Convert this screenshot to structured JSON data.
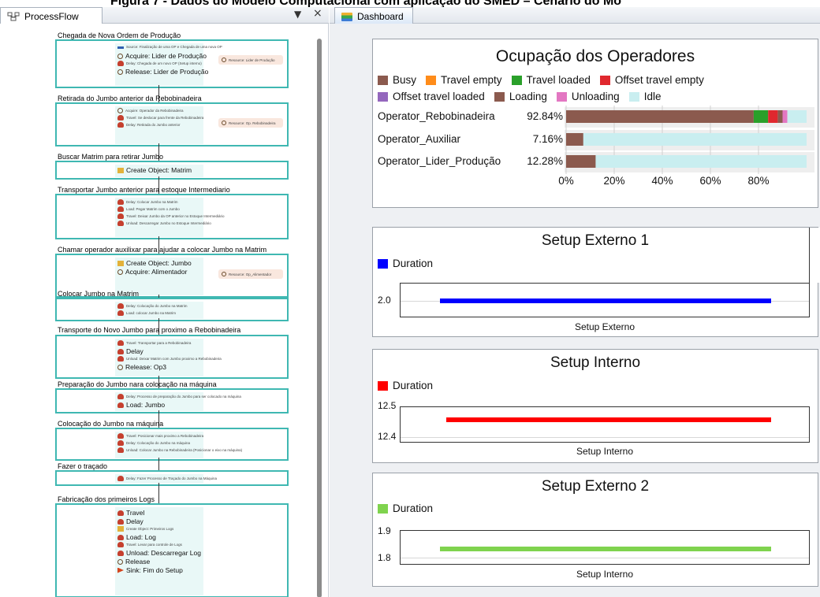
{
  "caption": "Figura 7 - Dados do Modelo Computacional com aplicação do SMED – Cenário do Mo",
  "left_panel": {
    "tab_label": "ProcessFlow",
    "pin_glyph": "▼",
    "close_glyph": "×",
    "blocks": [
      {
        "title": "Chegada de Nova Ordem de Produção",
        "activities": [
          {
            "text": "Source: Finalização de uma OP e Chegada de uma nova OP",
            "size": "sm",
            "icon": "source"
          },
          {
            "text": "Acquire: Lider de Produção",
            "size": "big",
            "icon": "acquire"
          },
          {
            "text": "Delay: Chegada de um novo OP (Setup interno)",
            "size": "sm",
            "icon": "delay"
          },
          {
            "text": "Release: Lider de Produção",
            "size": "big",
            "icon": "release"
          }
        ],
        "resource": "Resource: Lider de Produção"
      },
      {
        "title": "Retirada do Jumbo anterior da Rebobinadeira",
        "activities": [
          {
            "text": "Acquire: Operador da Rebobinadeira",
            "size": "sm",
            "icon": "acquire"
          },
          {
            "text": "Travel: Se deslocar para frente da Rebobinadeira",
            "size": "sm",
            "icon": "travel"
          },
          {
            "text": "Delay: Retirada do Jumbo anterior",
            "size": "sm",
            "icon": "delay"
          }
        ],
        "resource": "Resource: Op. Rebobinadeira"
      },
      {
        "title": "Buscar Matrim para retirar Jumbo",
        "activities": [
          {
            "text": "Create Object: Matrim",
            "size": "big",
            "icon": "create"
          }
        ],
        "resource": ""
      },
      {
        "title": "Transportar Jumbo anterior  para estoque Intermediario",
        "activities": [
          {
            "text": "Delay: Colocar Jumbo na Matrim",
            "size": "sm",
            "icon": "delay"
          },
          {
            "text": "Load: Pegar Matrim com o Jumbo",
            "size": "sm",
            "icon": "load"
          },
          {
            "text": "Travel: Deixar Jumbo da OP anterior no Estoque Intermediário",
            "size": "sm",
            "icon": "travel"
          },
          {
            "text": "Unload: Descarregar Jumbo no Estoque Intermediário",
            "size": "sm",
            "icon": "unload"
          }
        ],
        "resource": ""
      },
      {
        "title": "Chamar operador auxilixar para ajudar a colocar Jumbo na Matrim",
        "activities": [
          {
            "text": "Create Object: Jumbo",
            "size": "big",
            "icon": "create"
          },
          {
            "text": "Acquire: Alimentador",
            "size": "big",
            "icon": "acquire"
          }
        ],
        "resource": "Resource: Op_Alimentador"
      },
      {
        "title": "Colocar Jumbo na Matrim",
        "activities": [
          {
            "text": "Delay: Colocação do Jumbo na Matrim",
            "size": "sm",
            "icon": "delay"
          },
          {
            "text": "Load: colocar Jumbo na Matrim",
            "size": "sm",
            "icon": "load"
          }
        ],
        "resource": ""
      },
      {
        "title": "Transporte do Novo Jumbo para proximo a Rebobinadeira",
        "activities": [
          {
            "text": "Travel: Transportar para a Rebobinadeira",
            "size": "sm",
            "icon": "travel"
          },
          {
            "text": "Delay",
            "size": "big",
            "icon": "delay"
          },
          {
            "text": "Unload: Deixar Matrim com Jumbo proximo a Rebobinadeira",
            "size": "sm",
            "icon": "unload"
          },
          {
            "text": "Release: Op3",
            "size": "big",
            "icon": "release"
          }
        ],
        "resource": ""
      },
      {
        "title": "Preparação do Jumbo nara colocação na máquina",
        "activities": [
          {
            "text": "Delay: Processo de preparação do Jumbo para ser colocado na máquina",
            "size": "sm",
            "icon": "delay"
          },
          {
            "text": "Load: Jumbo",
            "size": "big",
            "icon": "load"
          }
        ],
        "resource": ""
      },
      {
        "title": "Colocação do Jumbo na máquina",
        "activities": [
          {
            "text": "Travel: Posicionar mais proximo a Rebobinadeira",
            "size": "sm",
            "icon": "travel"
          },
          {
            "text": "Delay: Colocação do Jumbo na máquina",
            "size": "sm",
            "icon": "delay"
          },
          {
            "text": "Unload: Colocar Jumbo na Rebobinadeira (Posicionar o eixo na máquina)",
            "size": "sm",
            "icon": "unload"
          }
        ],
        "resource": ""
      },
      {
        "title": "Fazer o traçado",
        "activities": [
          {
            "text": "Delay: Fazer Processo de Traçado do Jumbo na Máquina",
            "size": "sm",
            "icon": "delay"
          }
        ],
        "resource": ""
      },
      {
        "title": "Fabricação dos primeiros Logs",
        "activities": [
          {
            "text": "Travel",
            "size": "big",
            "icon": "travel"
          },
          {
            "text": "Delay",
            "size": "big",
            "icon": "delay"
          },
          {
            "text": "Create Object: Primeiros Logs",
            "size": "sm",
            "icon": "create"
          },
          {
            "text": "Load: Log",
            "size": "big",
            "icon": "load"
          },
          {
            "text": "Travel: Levar para controle de Logs",
            "size": "sm",
            "icon": "travel"
          },
          {
            "text": "Unload: Descarregar Log",
            "size": "big",
            "icon": "unload"
          },
          {
            "text": "Release",
            "size": "big",
            "icon": "release"
          },
          {
            "text": "Sink: Fim do Setup",
            "size": "big",
            "icon": "sink"
          }
        ],
        "resource": ""
      }
    ]
  },
  "right_panel": {
    "tab_label": "Dashboard"
  },
  "colors": {
    "busy": "#8b5a4e",
    "travel_empty": "#ff8c1a",
    "travel_loaded": "#2aa02a",
    "offset_travel_empty": "#e0282e",
    "offset_travel_loaded": "#9467bd",
    "loading": "#8b5a4e",
    "unloading": "#e377c2",
    "idle": "#c9eef0",
    "setup_externo_1": "#0000ff",
    "setup_interno": "#ff0000",
    "setup_externo_2": "#7fd34e"
  },
  "chart_data": [
    {
      "type": "bar",
      "title": "Ocupação dos Operadores",
      "orientation": "horizontal-stacked",
      "legend": [
        "Busy",
        "Travel empty",
        "Travel loaded",
        "Offset travel empty",
        "Offset travel loaded",
        "Loading",
        "Unloading",
        "Idle"
      ],
      "legend_placement": "top",
      "categories": [
        "Operator_Rebobinadeira",
        "Operator_Auxiliar",
        "Operator_Lider_Produção"
      ],
      "percent_labels": [
        "92.84%",
        "7.16%",
        "12.28%"
      ],
      "series": [
        {
          "name": "Busy",
          "values": [
            78,
            7.16,
            12.28
          ]
        },
        {
          "name": "Travel empty",
          "values": [
            0,
            0,
            0
          ]
        },
        {
          "name": "Travel loaded",
          "values": [
            6,
            0,
            0
          ]
        },
        {
          "name": "Offset travel empty",
          "values": [
            4,
            0,
            0
          ]
        },
        {
          "name": "Offset travel loaded",
          "values": [
            0,
            0,
            0
          ]
        },
        {
          "name": "Loading",
          "values": [
            2,
            0,
            0
          ]
        },
        {
          "name": "Unloading",
          "values": [
            2,
            0,
            0
          ]
        },
        {
          "name": "Idle",
          "values": [
            8,
            92.84,
            87.72
          ]
        }
      ],
      "xticks": [
        "0%",
        "20%",
        "40%",
        "60%",
        "80%"
      ],
      "xlim": [
        0,
        100
      ],
      "grid": true
    },
    {
      "type": "bar",
      "title": "Setup Externo 1",
      "legend": [
        "Duration"
      ],
      "legend_placement": "top-left",
      "yticks": [
        "2.0"
      ],
      "xlabel": "Setup Externo",
      "series": [
        {
          "name": "Duration",
          "values": [
            2.0
          ]
        }
      ]
    },
    {
      "type": "bar",
      "title": "Setup Interno",
      "legend": [
        "Duration"
      ],
      "legend_placement": "top-left",
      "yticks": [
        "12.5",
        "12.4"
      ],
      "ylim": [
        12.36,
        12.5
      ],
      "xlabel": "Setup Interno",
      "series": [
        {
          "name": "Duration",
          "values": [
            12.45
          ]
        }
      ]
    },
    {
      "type": "bar",
      "title": "Setup Externo 2",
      "legend": [
        "Duration"
      ],
      "legend_placement": "top-left",
      "yticks": [
        "1.9",
        "1.8"
      ],
      "ylim": [
        1.76,
        1.93
      ],
      "xlabel": "Setup Interno",
      "series": [
        {
          "name": "Duration",
          "values": [
            1.84
          ]
        }
      ]
    }
  ]
}
